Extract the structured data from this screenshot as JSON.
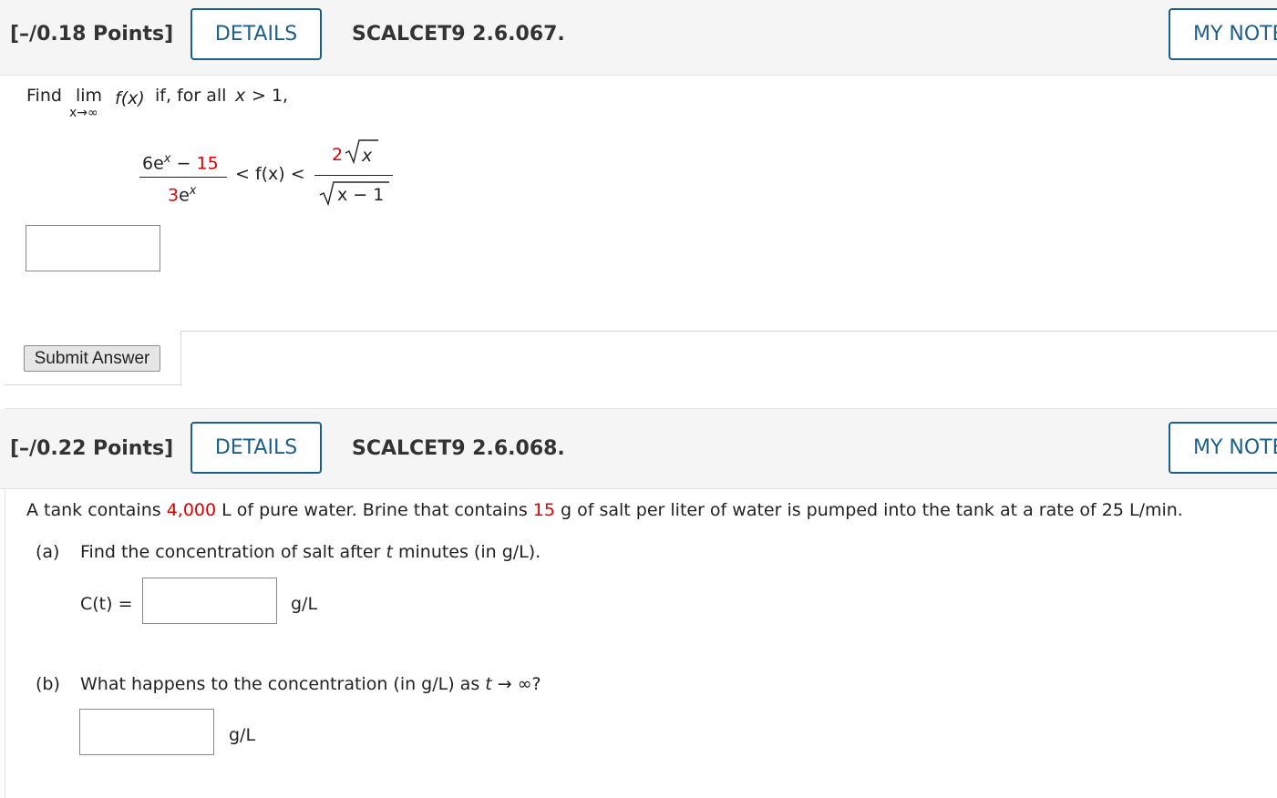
{
  "q1": {
    "points": "[–/0.18 Points]",
    "details_label": "DETAILS",
    "code": "SCALCET9 2.6.067.",
    "mynotes_label": "MY NOTES",
    "prompt_find": "Find",
    "prompt_lim": "lim",
    "prompt_sub": "x→∞",
    "prompt_fx": "f(x)",
    "prompt_rest": "if, for all",
    "prompt_x": "x",
    "prompt_cond": "> 1,",
    "num_left_a": "6e",
    "num_left_exp": "x",
    "num_left_b": " − ",
    "num_left_c": "15",
    "den_left_a": "3",
    "den_left_b": "e",
    "den_left_exp": "x",
    "mid": "< f(x) <",
    "num_right_a": "2",
    "num_right_b": "x",
    "den_right": "x − 1",
    "answer_value": "",
    "submit_label": "Submit Answer"
  },
  "q2": {
    "points": "[–/0.22 Points]",
    "details_label": "DETAILS",
    "code": "SCALCET9 2.6.068.",
    "mynotes_label": "MY NOTES",
    "intro_a": "A tank contains ",
    "intro_vol": "4,000",
    "intro_b": " L of pure water. Brine that contains ",
    "intro_salt": "15",
    "intro_c": " g of salt per liter of water is pumped into the tank at a rate of 25 L/min.",
    "part_a_label": "(a)",
    "part_a_text": "Find the concentration of salt after",
    "part_a_t": "t",
    "part_a_rest": "minutes (in g/L).",
    "ct_label": "C(t) =",
    "ct_value": "",
    "ct_unit": "g/L",
    "part_b_label": "(b)",
    "part_b_text": "What happens to the concentration (in g/L) as",
    "part_b_t": "t",
    "part_b_rest": "→ ∞?",
    "b_value": "",
    "b_unit": "g/L"
  }
}
